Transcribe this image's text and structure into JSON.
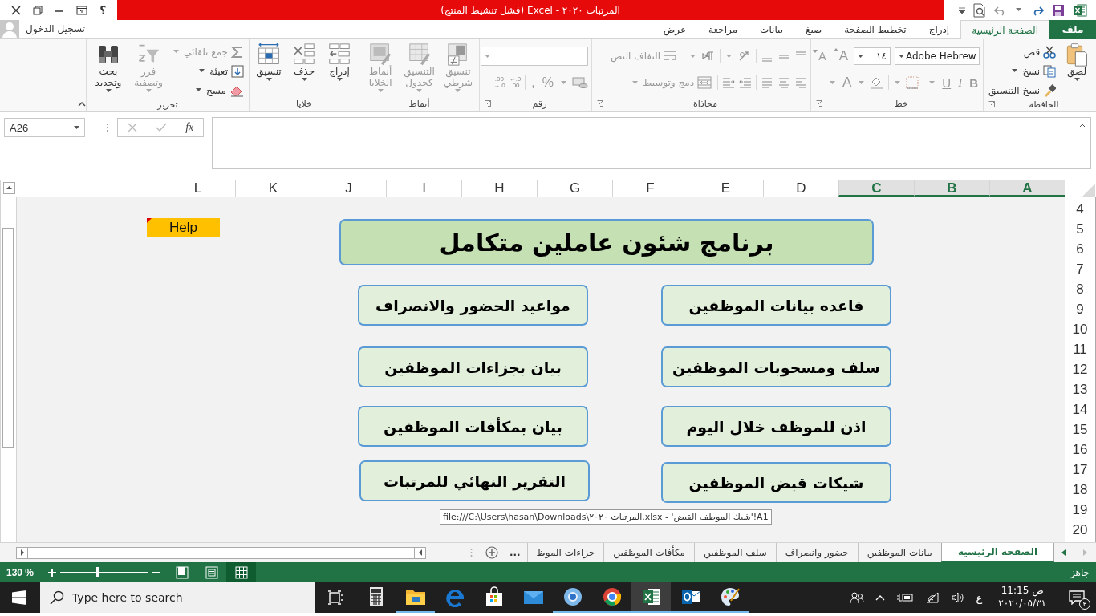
{
  "title_bar": {
    "title": "المرتبات ٢٠٢٠ - Excel (فشل تنشيط المنتج)",
    "help": "؟"
  },
  "account": {
    "label": "تسجيل الدخول"
  },
  "tabs": [
    {
      "label": "ملف",
      "kind": "file",
      "selected": false
    },
    {
      "label": "الصفحة الرئيسية",
      "kind": "tab",
      "selected": true
    },
    {
      "label": "إدراج",
      "kind": "tab",
      "selected": false
    },
    {
      "label": "تخطيط الصفحة",
      "kind": "tab",
      "selected": false
    },
    {
      "label": "صيغ",
      "kind": "tab",
      "selected": false
    },
    {
      "label": "بيانات",
      "kind": "tab",
      "selected": false
    },
    {
      "label": "مراجعة",
      "kind": "tab",
      "selected": false
    },
    {
      "label": "عرض",
      "kind": "tab",
      "selected": false
    }
  ],
  "ribbon": {
    "groups": [
      {
        "kind": "clipboard",
        "label": "الحافظة",
        "paste": {
          "label": "لصق",
          "disabled": false
        },
        "commands": [
          {
            "kind": "cut",
            "label": "قص",
            "disabled": false
          },
          {
            "kind": "copy",
            "label": "نسخ",
            "disabled": false
          },
          {
            "kind": "format-painter",
            "label": "نسخ التنسيق",
            "disabled": false
          }
        ]
      },
      {
        "kind": "font",
        "label": "خط",
        "font_name": "Adobe Hebrew",
        "font_size": "١٤",
        "grow": "A",
        "shrink": "A",
        "styles": [
          "B",
          "I",
          "U"
        ],
        "font_color": "A"
      },
      {
        "kind": "alignment",
        "label": "محاذاة",
        "commands": [
          {
            "kind": "wrap-text",
            "label": "التفاف النص",
            "disabled": true
          },
          {
            "kind": "merge",
            "label": "دمج وتوسيط",
            "disabled": true
          }
        ]
      },
      {
        "kind": "number",
        "label": "رقم",
        "symbols": [
          "%",
          ","
        ],
        "decimals": [
          {
            "top": "←.0",
            "bottom": ".00"
          },
          {
            "top": ".00",
            "bottom": "→.0"
          }
        ]
      },
      {
        "kind": "styles",
        "label": "أنماط",
        "commands": [
          {
            "kind": "conditional-format",
            "label": "تنسيق شرطي",
            "disabled": true
          },
          {
            "kind": "format-table",
            "label": "التنسيق كجدول",
            "disabled": true
          },
          {
            "kind": "cell-styles",
            "label": "أنماط الخلايا",
            "disabled": true
          }
        ]
      },
      {
        "kind": "cells",
        "label": "خلايا",
        "commands": [
          {
            "kind": "insert",
            "label": "إدراج",
            "disabled": false
          },
          {
            "kind": "delete",
            "label": "حذف",
            "disabled": false
          },
          {
            "kind": "format",
            "label": "تنسيق",
            "disabled": false
          }
        ]
      },
      {
        "kind": "editing",
        "label": "تحرير",
        "commands": [
          {
            "kind": "autosum",
            "label": "جمع تلقائي",
            "disabled": true
          },
          {
            "kind": "fill",
            "label": "تعبئة",
            "disabled": false
          },
          {
            "kind": "clear",
            "label": "مسح",
            "disabled": false
          },
          {
            "kind": "sort",
            "label": "فرز وتصفية",
            "disabled": true
          },
          {
            "kind": "find",
            "label": "بحث وتحديد",
            "disabled": false
          }
        ]
      }
    ]
  },
  "formula_bar": {
    "name_box": "A26",
    "function_label": "fx"
  },
  "sheet": {
    "columns": [
      {
        "label": "A",
        "selected": true
      },
      {
        "label": "B",
        "selected": true
      },
      {
        "label": "C",
        "selected": true
      },
      {
        "label": "D",
        "selected": false
      },
      {
        "label": "E",
        "selected": false
      },
      {
        "label": "F",
        "selected": false
      },
      {
        "label": "G",
        "selected": false
      },
      {
        "label": "H",
        "selected": false
      },
      {
        "label": "I",
        "selected": false
      },
      {
        "label": "J",
        "selected": false
      },
      {
        "label": "K",
        "selected": false
      },
      {
        "label": "L",
        "selected": false
      }
    ],
    "rows": [
      "4",
      "5",
      "6",
      "7",
      "8",
      "9",
      "10",
      "11",
      "12",
      "13",
      "14",
      "15",
      "16",
      "17",
      "18",
      "19",
      "20"
    ],
    "help_cell": {
      "text": "Help",
      "comment": true
    },
    "title": "برنامج شئون عاملين متكامل",
    "buttons": [
      "قاعده بيانات الموظفين",
      "مواعيد الحضور والانصراف",
      "سلف ومسحوبات الموظفين",
      "بيان بجزاءات الموظفين",
      "اذن للموظف خلال اليوم",
      "بيان بمكأفات الموظفين",
      "شيكات قبض الموظفين",
      "التقرير النهائي للمرتبات"
    ],
    "link_tooltip": "file:///C:\\Users\\hasan\\Downloads\\المرتبات ٢٠٢٠.xlsx - 'شيك الموظف القبض'!A1"
  },
  "sheet_tabs": {
    "tabs": [
      {
        "label": "الصفحه الرئيسيه",
        "selected": true
      },
      {
        "label": "بيانات الموظفين",
        "selected": false
      },
      {
        "label": "حضور وانصراف",
        "selected": false
      },
      {
        "label": "سلف الموظفين",
        "selected": false
      },
      {
        "label": "مكأفات الموظفين",
        "selected": false
      },
      {
        "label": "جزاءات الموظ",
        "selected": false
      }
    ],
    "more": "..."
  },
  "status_bar": {
    "status": "جاهز",
    "zoom": "130 %",
    "views": [
      {
        "kind": "normal",
        "selected": true
      },
      {
        "kind": "page-layout",
        "selected": false
      },
      {
        "kind": "page-break",
        "selected": false
      }
    ]
  },
  "taskbar": {
    "search_placeholder": "Type here to search",
    "apps": [
      {
        "kind": "calculator",
        "running": false,
        "selected": false
      },
      {
        "kind": "explorer",
        "running": true,
        "selected": false
      },
      {
        "kind": "edge",
        "running": false,
        "selected": false
      },
      {
        "kind": "store",
        "running": false,
        "selected": false
      },
      {
        "kind": "mail",
        "running": false,
        "selected": false
      },
      {
        "kind": "chromium",
        "running": true,
        "selected": false
      },
      {
        "kind": "chrome",
        "running": true,
        "selected": false
      },
      {
        "kind": "excel",
        "running": true,
        "selected": true
      },
      {
        "kind": "outlook",
        "running": true,
        "selected": false
      },
      {
        "kind": "paint",
        "running": true,
        "selected": false
      }
    ],
    "language": "ع",
    "time": "ص 11:15",
    "date": "٢٠٢٠/٠٥/٣١",
    "notifications": "٢"
  }
}
